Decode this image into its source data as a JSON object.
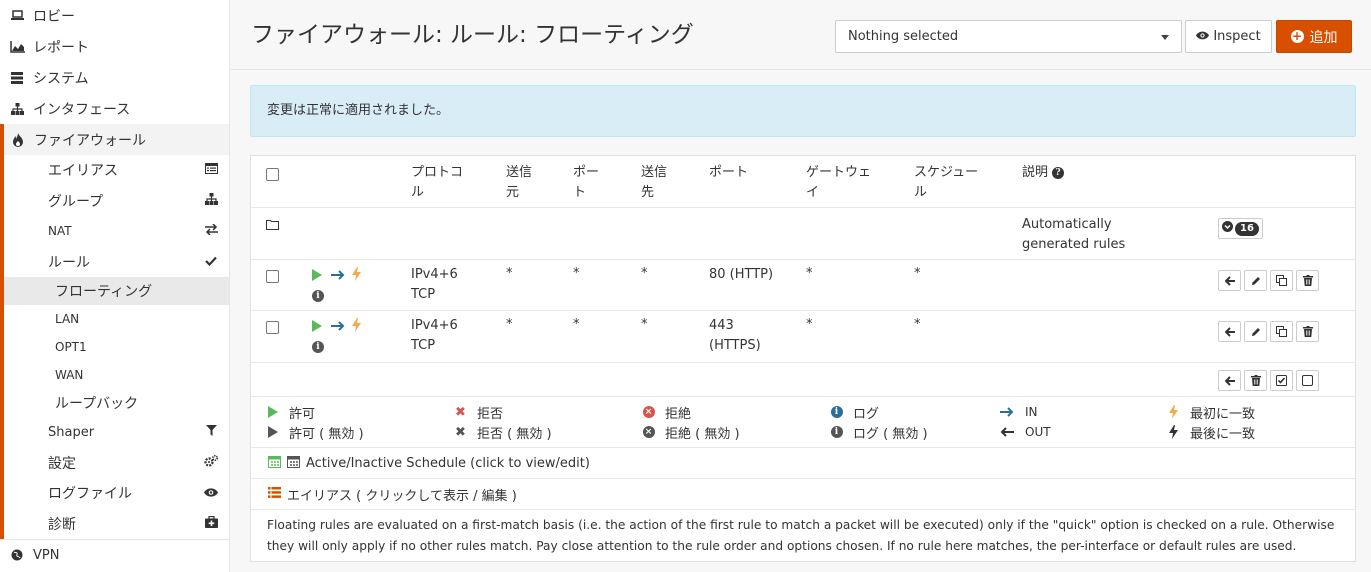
{
  "sidebar": {
    "top_items": [
      {
        "label": "ロビー",
        "icon": "laptop-icon"
      },
      {
        "label": "レポート",
        "icon": "area-chart-icon"
      },
      {
        "label": "システム",
        "icon": "server-icon"
      },
      {
        "label": "インタフェース",
        "icon": "sitemap-icon"
      }
    ],
    "firewall": {
      "label": "ファイアウォール",
      "icon": "fire-icon"
    },
    "firewall_items": [
      {
        "label": "エイリアス",
        "icon": "list-alt-icon"
      },
      {
        "label": "グループ",
        "icon": "sitemap-icon"
      },
      {
        "label": "NAT",
        "icon": "exchange-icon"
      },
      {
        "label": "ルール",
        "icon": "check-icon"
      }
    ],
    "rules_items": [
      "フローティング",
      "LAN",
      "OPT1",
      "WAN",
      "ループバック"
    ],
    "lower_items": [
      {
        "label": "Shaper",
        "icon": "filter-icon"
      },
      {
        "label": "設定",
        "icon": "cogs-icon"
      },
      {
        "label": "ログファイル",
        "icon": "eye-icon"
      },
      {
        "label": "診断",
        "icon": "medkit-icon"
      }
    ],
    "vpn": {
      "label": "VPN",
      "icon": "globe-icon"
    }
  },
  "header": {
    "title": "ファイアウォール: ルール: フローティング",
    "select_value": "Nothing selected",
    "inspect_label": "Inspect",
    "add_label": "追加"
  },
  "alert": {
    "text": "変更は正常に適用されました。"
  },
  "table": {
    "columns": [
      "プロトコル",
      "送信元",
      "ポート",
      "送信先",
      "ポート",
      "ゲートウェイ",
      "スケジュール",
      "説明"
    ],
    "auto_rules": {
      "description": "Automatically generated rules",
      "count": "16"
    },
    "rows": [
      {
        "protocol": [
          "IPv4+6",
          "TCP"
        ],
        "source": "*",
        "src_port": "*",
        "destination": "*",
        "dst_port": [
          "80 (HTTP)"
        ],
        "gateway": "*",
        "schedule": "*"
      },
      {
        "protocol": [
          "IPv4+6",
          "TCP"
        ],
        "source": "*",
        "src_port": "*",
        "destination": "*",
        "dst_port": [
          "443",
          "(HTTPS)"
        ],
        "gateway": "*",
        "schedule": "*"
      }
    ]
  },
  "legend": {
    "pass": "許可",
    "pass_disabled": "許可 ( 無効 )",
    "block": "拒否",
    "block_disabled": "拒否 ( 無効 )",
    "reject": "拒絶",
    "reject_disabled": "拒絶 ( 無効 )",
    "log": "ログ",
    "log_disabled": "ログ ( 無効 )",
    "in": "IN",
    "out": "OUT",
    "first_match": "最初に一致",
    "last_match": "最後に一致",
    "schedule": "Active/Inactive Schedule (click to view/edit)",
    "alias": "エイリアス ( クリックして表示 / 編集 )"
  },
  "footer_note": "Floating rules are evaluated on a first-match basis (i.e. the action of the first rule to match a packet will be executed) only if the \"quick\" option is checked on a rule. Otherwise they will only apply if no other rules match. Pay close attention to the rule order and options chosen. If no rule here matches, the per-interface or default rules are used.",
  "colors": {
    "accent": "#d94f00",
    "pass": "#5cb85c",
    "block": "#d9534f",
    "info": "#2c6e9b",
    "alert_bg": "#d9edf7"
  }
}
